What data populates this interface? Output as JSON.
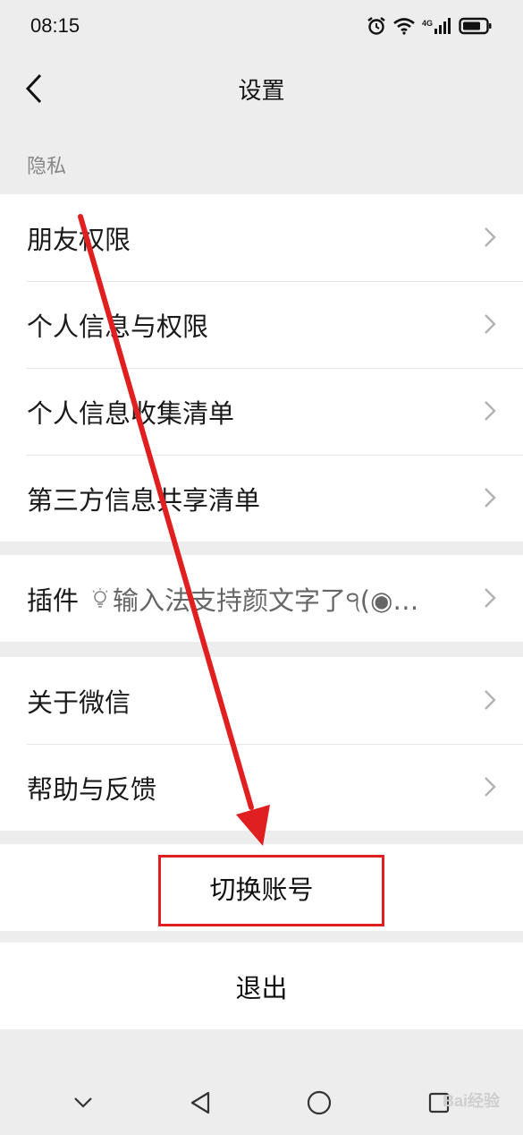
{
  "status_bar": {
    "time": "08:15",
    "network": "4G"
  },
  "header": {
    "title": "设置"
  },
  "privacy": {
    "section_label": "隐私",
    "items": [
      {
        "label": "朋友权限"
      },
      {
        "label": "个人信息与权限"
      },
      {
        "label": "个人信息收集清单"
      },
      {
        "label": "第三方信息共享清单"
      }
    ]
  },
  "plugins": {
    "label": "插件",
    "extra": "输入法支持颜文字了੧(◉…"
  },
  "about": {
    "items": [
      {
        "label": "关于微信"
      },
      {
        "label": "帮助与反馈"
      }
    ]
  },
  "actions": {
    "switch_account": "切换账号",
    "logout": "退出"
  },
  "watermark": "Bai经验",
  "colors": {
    "annotation": "#e02020",
    "background": "#ededed"
  }
}
